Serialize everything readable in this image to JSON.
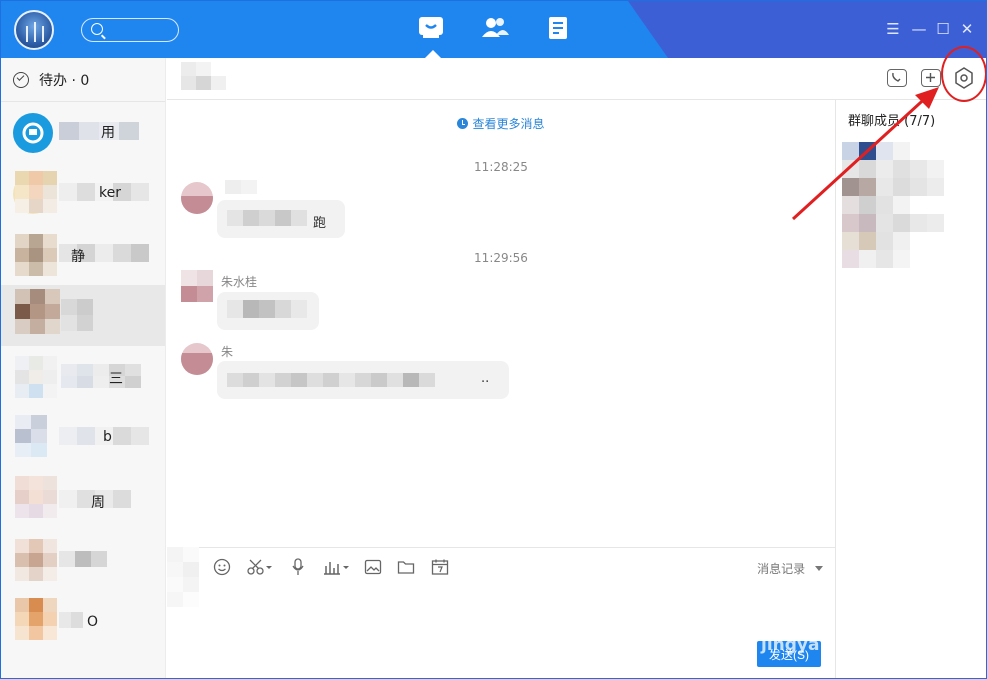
{
  "topbar": {
    "nav": [
      {
        "name": "messages",
        "active": true
      },
      {
        "name": "contacts",
        "active": false
      },
      {
        "name": "workbench",
        "active": false
      }
    ],
    "window_controls": {
      "menu": "☰",
      "minimize": "—",
      "maximize": "☐",
      "close": "✕"
    }
  },
  "sidebar": {
    "todo_label": "待办 · 0",
    "conversations": [
      {
        "name": "用",
        "active": false
      },
      {
        "name": "ker",
        "active": false
      },
      {
        "name": "静",
        "active": false
      },
      {
        "name": "",
        "active": true
      },
      {
        "name": "三",
        "active": false
      },
      {
        "name": "b",
        "active": false
      },
      {
        "name": "周",
        "active": false
      },
      {
        "name": "",
        "active": false
      },
      {
        "name": "O",
        "active": false
      }
    ]
  },
  "chat": {
    "header_title": "",
    "more_messages": "查看更多消息",
    "timestamps": [
      "11:28:25",
      "11:29:56"
    ],
    "messages": [
      {
        "sender": "",
        "text": "跑"
      },
      {
        "sender": "朱水桂",
        "text": ""
      },
      {
        "sender": "朱",
        "text": ".."
      }
    ]
  },
  "members": {
    "title": "群聊成员 (7/7)",
    "count_text": "7/7"
  },
  "toolbar": {
    "history_label": "消息记录"
  },
  "input": {
    "send_label": "发送(S)",
    "watermark": "jingya"
  },
  "colors": {
    "brand": "#1f86f0",
    "topbar_dark": "#3d5fd6",
    "annotation": "#e02020"
  }
}
